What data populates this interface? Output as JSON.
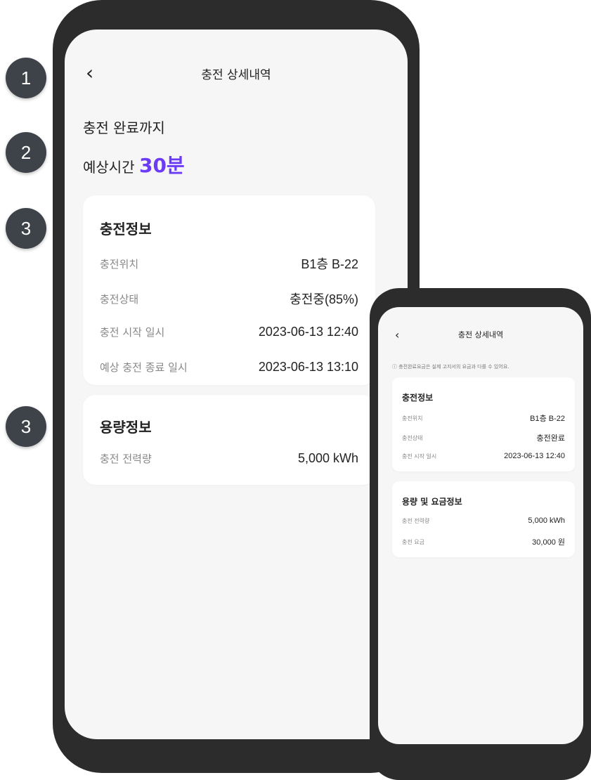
{
  "markers": [
    "1",
    "2",
    "3",
    "3"
  ],
  "big_phone": {
    "header": {
      "back_icon": "‹",
      "title": "충전 상세내역"
    },
    "summary": {
      "line1": "충전 완료까지",
      "line2_prefix": "예상시간 ",
      "time": "30분",
      "accent_color": "#6c3bf5"
    },
    "charging_info": {
      "title": "충전정보",
      "rows": [
        {
          "label": "충전위치",
          "value": "B1층 B-22"
        },
        {
          "label": "충전상태",
          "value": "충전중(85%)"
        },
        {
          "label": "충전 시작 일시",
          "value": "2023-06-13 12:40"
        },
        {
          "label": "예상 충전 종료 일시",
          "value": "2023-06-13 13:10"
        }
      ]
    },
    "capacity_info": {
      "title": "용량정보",
      "rows": [
        {
          "label": "충전 전력량",
          "value": "5,000 kWh"
        }
      ]
    }
  },
  "small_phone": {
    "header": {
      "back_icon": "‹",
      "title": "충전 상세내역"
    },
    "notice": "ⓘ 충전완료요금은 실제 고지서의 요금과 다를 수 있어요.",
    "charging_info": {
      "title": "충전정보",
      "rows": [
        {
          "label": "충전위치",
          "value": "B1층 B-22"
        },
        {
          "label": "충전상태",
          "value": "충전완료"
        },
        {
          "label": "충전 시작 일시",
          "value": "2023-06-13 12:40"
        }
      ]
    },
    "capacity_fee_info": {
      "title": "용량 및 요금정보",
      "rows": [
        {
          "label": "충전 전력량",
          "value": "5,000 kWh"
        },
        {
          "label": "충전 요금",
          "value": "30,000 원"
        }
      ]
    }
  }
}
